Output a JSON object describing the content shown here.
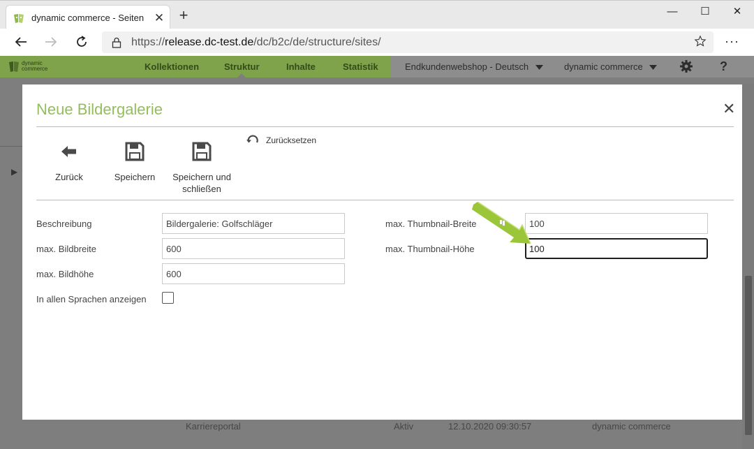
{
  "browser": {
    "tab_title": "dynamic commerce - Seiten",
    "tab_close": "✕",
    "new_tab": "+",
    "url_prefix": "https://",
    "url_host": "release.dc-test.de",
    "url_path": "/dc/b2c/de/structure/sites/",
    "window": {
      "minimize": "—",
      "maximize": "☐",
      "close": "✕"
    },
    "more": "···"
  },
  "app_header": {
    "logo_text_1": "dynamic",
    "logo_text_2": "commerce",
    "nav": [
      "Kollektionen",
      "Struktur",
      "Inhalte",
      "Statistik"
    ],
    "shop_select": "Endkundenwebshop - Deutsch",
    "company_select": "dynamic commerce",
    "help": "?"
  },
  "background_row": {
    "name": "Karriereportal",
    "status": "Aktiv",
    "date": "12.10.2020 09:30:57",
    "owner": "dynamic commerce"
  },
  "modal": {
    "title": "Neue Bildergalerie",
    "close": "✕",
    "toolbar": {
      "back_label": "Zurück",
      "save_label": "Speichern",
      "save_close_label_1": "Speichern und",
      "save_close_label_2": "schließen",
      "reset_label": "Zurücksetzen"
    },
    "form": {
      "description_label": "Beschreibung",
      "description_value": "Bildergalerie: Golfschläger",
      "max_width_label": "max. Bildbreite",
      "max_width_value": "600",
      "max_height_label": "max. Bildhöhe",
      "max_height_value": "600",
      "all_languages_label": "In allen Sprachen anzeigen",
      "all_languages_checked": false,
      "thumb_width_label": "max. Thumbnail-Breite",
      "thumb_width_value": "100",
      "thumb_height_label": "max. Thumbnail-Höhe",
      "thumb_height_value": "100"
    }
  },
  "colors": {
    "brand_green": "#94be5c",
    "header_green": "#7ea34a",
    "overlay_gray": "#7e7e7e",
    "annotation_arrow": "#9cc63a"
  }
}
